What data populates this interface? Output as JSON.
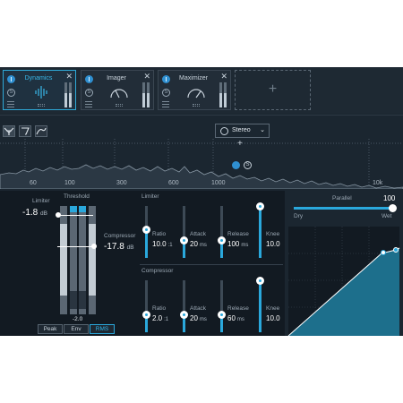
{
  "modules": [
    {
      "title": "Dynamics",
      "icon": "waveform-icon",
      "active": true
    },
    {
      "title": "Imager",
      "icon": "imager-gauge-icon",
      "active": false
    },
    {
      "title": "Maximizer",
      "icon": "maximizer-gauge-icon",
      "active": false
    }
  ],
  "module_solo_glyph": "S",
  "module_close_glyph": "✕",
  "add_module_glyph": "+",
  "toolbar": {
    "mode_icons": [
      "crossover-icon",
      "eq-curve-icon",
      "spectrum-curve-icon"
    ],
    "stereo_label": "Stereo",
    "stereo_chevron": "⌄",
    "band_solo_glyph": "S",
    "plus_glyph": "+"
  },
  "spectrum": {
    "freq_labels": [
      "60",
      "100",
      "300",
      "600",
      "1000",
      "10k"
    ]
  },
  "left_panel": {
    "limiter_label": "Limiter",
    "threshold_label": "Threshold",
    "limiter_value": "-1.8",
    "limiter_unit": "dB",
    "compressor_label": "Compressor",
    "compressor_value": "-17.8",
    "compressor_unit": "dB",
    "gr_readout": "-2.0",
    "detection_buttons": [
      "Peak",
      "Env",
      "RMS"
    ],
    "detection_selected": "RMS"
  },
  "limiter_section": {
    "label": "Limiter",
    "params": [
      {
        "name": "Ratio",
        "value": "10.0",
        "unit": ":1",
        "level": 0.55
      },
      {
        "name": "Attack",
        "value": "20",
        "unit": "ms",
        "level": 0.35
      },
      {
        "name": "Release",
        "value": "100",
        "unit": "ms",
        "level": 0.35
      },
      {
        "name": "Knee",
        "value": "10.0",
        "unit": "",
        "level": 1.0
      }
    ]
  },
  "compressor_section": {
    "label": "Compressor",
    "params": [
      {
        "name": "Ratio",
        "value": "2.0",
        "unit": ":1",
        "level": 0.35
      },
      {
        "name": "Attack",
        "value": "20",
        "unit": "ms",
        "level": 0.35
      },
      {
        "name": "Release",
        "value": "60",
        "unit": "ms",
        "level": 0.35
      },
      {
        "name": "Knee",
        "value": "10.0",
        "unit": "",
        "level": 1.0
      }
    ]
  },
  "parallel": {
    "label": "Parallel",
    "value": "100",
    "dry_label": "Dry",
    "wet_label": "Wet",
    "amount": 1.0
  },
  "colors": {
    "accent": "#2aa8dc",
    "panel": "#121a22",
    "background": "#1b2630",
    "transfer_fill": "#1d6f8c"
  }
}
